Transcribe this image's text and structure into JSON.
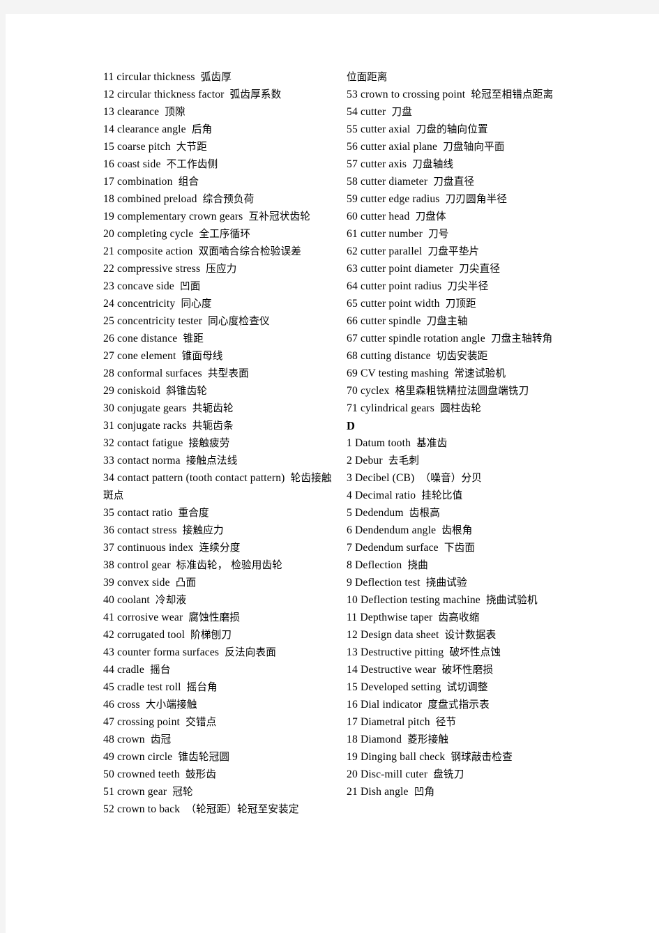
{
  "page": {
    "background_color": "#f4f4f4",
    "paper_color": "#ffffff",
    "text_color": "#000000"
  },
  "columns": {
    "left": {
      "blocks": [
        {
          "kind": "entry",
          "num": "11",
          "term": "circular thickness",
          "cn": "弧齿厚"
        },
        {
          "kind": "entry",
          "num": "12",
          "term": "circular thickness factor",
          "cn": "弧齿厚系数"
        },
        {
          "kind": "entry",
          "num": "13",
          "term": "clearance",
          "cn": "顶隙"
        },
        {
          "kind": "entry",
          "num": "14",
          "term": "clearance angle",
          "cn": "后角"
        },
        {
          "kind": "entry",
          "num": "15",
          "term": "coarse pitch",
          "cn": "大节距"
        },
        {
          "kind": "entry",
          "num": "16",
          "term": "coast side",
          "cn": "不工作齿侧"
        },
        {
          "kind": "entry",
          "num": "17",
          "term": "combination",
          "cn": "组合"
        },
        {
          "kind": "entry",
          "num": "18",
          "term": "combined preload",
          "cn": "综合预负荷"
        },
        {
          "kind": "entry",
          "num": "19",
          "term": "complementary crown gears",
          "cn": "互补冠状齿轮"
        },
        {
          "kind": "entry",
          "num": "20",
          "term": "completing cycle",
          "cn": "全工序循环"
        },
        {
          "kind": "entry",
          "num": "21",
          "term": "composite action",
          "cn": "双面啮合综合检验误差"
        },
        {
          "kind": "entry",
          "num": "22",
          "term": "compressive stress",
          "cn": "压应力"
        },
        {
          "kind": "entry",
          "num": "23",
          "term": "concave side",
          "cn": "凹面"
        },
        {
          "kind": "entry",
          "num": "24",
          "term": "concentricity",
          "cn": "同心度"
        },
        {
          "kind": "entry",
          "num": "25",
          "term": "concentricity tester",
          "cn": "同心度检查仪"
        },
        {
          "kind": "entry",
          "num": "26",
          "term": "cone distance",
          "cn": "锥距"
        },
        {
          "kind": "entry",
          "num": "27",
          "term": "cone element",
          "cn": "锥面母线"
        },
        {
          "kind": "entry",
          "num": "28",
          "term": "conformal surfaces",
          "cn": "共型表面"
        },
        {
          "kind": "entry",
          "num": "29",
          "term": "coniskoid",
          "cn": "斜锥齿轮"
        },
        {
          "kind": "entry",
          "num": "30",
          "term": "conjugate gears",
          "cn": "共轭齿轮"
        },
        {
          "kind": "entry",
          "num": "31",
          "term": "conjugate racks",
          "cn": "共轭齿条"
        },
        {
          "kind": "entry",
          "num": "32",
          "term": "contact fatigue",
          "cn": "接触疲劳"
        },
        {
          "kind": "entry",
          "num": "33",
          "term": "contact norma",
          "cn": "接触点法线"
        },
        {
          "kind": "entry",
          "num": "34",
          "term": "contact pattern (tooth contact pattern)",
          "cn": "轮齿接触斑点"
        },
        {
          "kind": "entry",
          "num": "35",
          "term": "contact ratio",
          "cn": "重合度"
        },
        {
          "kind": "entry",
          "num": "36",
          "term": "contact stress",
          "cn": "接触应力"
        },
        {
          "kind": "entry",
          "num": "37",
          "term": "continuous index",
          "cn": "连续分度"
        },
        {
          "kind": "entry",
          "num": "38",
          "term": "control gear",
          "cn": "标准齿轮， 检验用齿轮"
        },
        {
          "kind": "entry",
          "num": "39",
          "term": "convex side",
          "cn": "凸面"
        },
        {
          "kind": "entry",
          "num": "40",
          "term": "coolant",
          "cn": "冷却液"
        },
        {
          "kind": "entry",
          "num": "41",
          "term": "corrosive wear",
          "cn": "腐蚀性磨损"
        },
        {
          "kind": "entry",
          "num": "42",
          "term": "corrugated tool",
          "cn": "阶梯刨刀"
        },
        {
          "kind": "entry",
          "num": "43",
          "term": "counter forma surfaces",
          "cn": "反法向表面"
        },
        {
          "kind": "entry",
          "num": "44",
          "term": "cradle",
          "cn": "摇台"
        },
        {
          "kind": "entry",
          "num": "45",
          "term": "cradle test roll",
          "cn": "摇台角"
        },
        {
          "kind": "entry",
          "num": "46",
          "term": "cross",
          "cn": "大小端接触"
        },
        {
          "kind": "entry",
          "num": "47",
          "term": "crossing point",
          "cn": "交错点"
        },
        {
          "kind": "entry",
          "num": "48",
          "term": "crown",
          "cn": "齿冠"
        },
        {
          "kind": "entry",
          "num": "49",
          "term": "crown circle",
          "cn": "锥齿轮冠圆"
        },
        {
          "kind": "entry",
          "num": "50",
          "term": "crowned teeth",
          "cn": "鼓形齿"
        },
        {
          "kind": "entry",
          "num": "51",
          "term": "crown gear",
          "cn": "冠轮"
        },
        {
          "kind": "entry",
          "num": "52",
          "term": "crown to back",
          "cn": "（轮冠距）轮冠至安装定"
        }
      ]
    },
    "right": {
      "blocks": [
        {
          "kind": "continuation",
          "cn": "位面距离"
        },
        {
          "kind": "entry",
          "num": "53",
          "term": "crown to crossing point",
          "cn": "轮冠至相错点距离"
        },
        {
          "kind": "entry",
          "num": "54",
          "term": "cutter",
          "cn": "刀盘"
        },
        {
          "kind": "entry",
          "num": "55",
          "term": "cutter axial",
          "cn": "刀盘的轴向位置"
        },
        {
          "kind": "entry",
          "num": "56",
          "term": "cutter axial plane",
          "cn": "刀盘轴向平面"
        },
        {
          "kind": "entry",
          "num": "57",
          "term": "cutter axis",
          "cn": "刀盘轴线"
        },
        {
          "kind": "entry",
          "num": "58",
          "term": "cutter diameter",
          "cn": "刀盘直径"
        },
        {
          "kind": "entry",
          "num": "59",
          "term": "cutter edge radius",
          "cn": "刀刃圆角半径"
        },
        {
          "kind": "entry",
          "num": "60",
          "term": "cutter head",
          "cn": "刀盘体"
        },
        {
          "kind": "entry",
          "num": "61",
          "term": "cutter number",
          "cn": "刀号"
        },
        {
          "kind": "entry",
          "num": "62",
          "term": "cutter parallel",
          "cn": "刀盘平垫片"
        },
        {
          "kind": "entry",
          "num": "63",
          "term": "cutter point diameter",
          "cn": "刀尖直径"
        },
        {
          "kind": "entry",
          "num": "64",
          "term": "cutter point radius",
          "cn": "刀尖半径"
        },
        {
          "kind": "entry",
          "num": "65",
          "term": "cutter point width",
          "cn": "刀顶距"
        },
        {
          "kind": "entry",
          "num": "66",
          "term": "cutter spindle",
          "cn": "刀盘主轴"
        },
        {
          "kind": "entry",
          "num": "67",
          "term": "cutter spindle rotation angle",
          "cn": "刀盘主轴转角"
        },
        {
          "kind": "entry",
          "num": "68",
          "term": "cutting distance",
          "cn": "切齿安装距"
        },
        {
          "kind": "entry",
          "num": "69",
          "term": "CV testing mashing",
          "cn": "常速试验机"
        },
        {
          "kind": "entry",
          "num": "70",
          "term": "cyclex",
          "cn": "格里森粗铣精拉法圆盘端铣刀"
        },
        {
          "kind": "entry",
          "num": "71",
          "term": "cylindrical gears",
          "cn": "圆柱齿轮"
        },
        {
          "kind": "heading",
          "label": "D"
        },
        {
          "kind": "entry",
          "num": "1",
          "term": "Datum tooth",
          "cn": "基准齿"
        },
        {
          "kind": "entry",
          "num": "2",
          "term": "Debur",
          "cn": "去毛刺"
        },
        {
          "kind": "entry",
          "num": "3",
          "term": "Decibel (CB)",
          "cn": "（噪音）分贝"
        },
        {
          "kind": "entry",
          "num": "4",
          "term": "Decimal ratio",
          "cn": "挂轮比值"
        },
        {
          "kind": "entry",
          "num": "5",
          "term": "Dedendum",
          "cn": "齿根高"
        },
        {
          "kind": "entry",
          "num": "6",
          "term": "Dendendum angle",
          "cn": "齿根角"
        },
        {
          "kind": "entry",
          "num": "7",
          "term": "Dedendum surface",
          "cn": "下齿面"
        },
        {
          "kind": "entry",
          "num": "8",
          "term": "Deflection",
          "cn": "挠曲"
        },
        {
          "kind": "entry",
          "num": "9",
          "term": "Deflection test",
          "cn": "挠曲试验"
        },
        {
          "kind": "entry",
          "num": "10",
          "term": "Deflection testing machine",
          "cn": "挠曲试验机"
        },
        {
          "kind": "entry",
          "num": "11",
          "term": "Depthwise taper",
          "cn": "齿高收缩"
        },
        {
          "kind": "entry",
          "num": "12",
          "term": "Design data sheet",
          "cn": "设计数据表"
        },
        {
          "kind": "entry",
          "num": "13",
          "term": "Destructive pitting",
          "cn": "破坏性点蚀"
        },
        {
          "kind": "entry",
          "num": "14",
          "term": "Destructive wear",
          "cn": "破坏性磨损"
        },
        {
          "kind": "entry",
          "num": "15",
          "term": "Developed setting",
          "cn": "试切调整"
        },
        {
          "kind": "entry",
          "num": "16",
          "term": "Dial indicator",
          "cn": "度盘式指示表"
        },
        {
          "kind": "entry",
          "num": "17",
          "term": "Diametral pitch",
          "cn": "径节"
        },
        {
          "kind": "entry",
          "num": "18",
          "term": "Diamond",
          "cn": "菱形接触"
        },
        {
          "kind": "entry",
          "num": "19",
          "term": "Dinging ball check",
          "cn": "钢球敲击检查"
        },
        {
          "kind": "entry",
          "num": "20",
          "term": "Disc-mill cuter",
          "cn": "盘铣刀"
        },
        {
          "kind": "entry",
          "num": "21",
          "term": "Dish angle",
          "cn": "凹角"
        }
      ]
    }
  }
}
